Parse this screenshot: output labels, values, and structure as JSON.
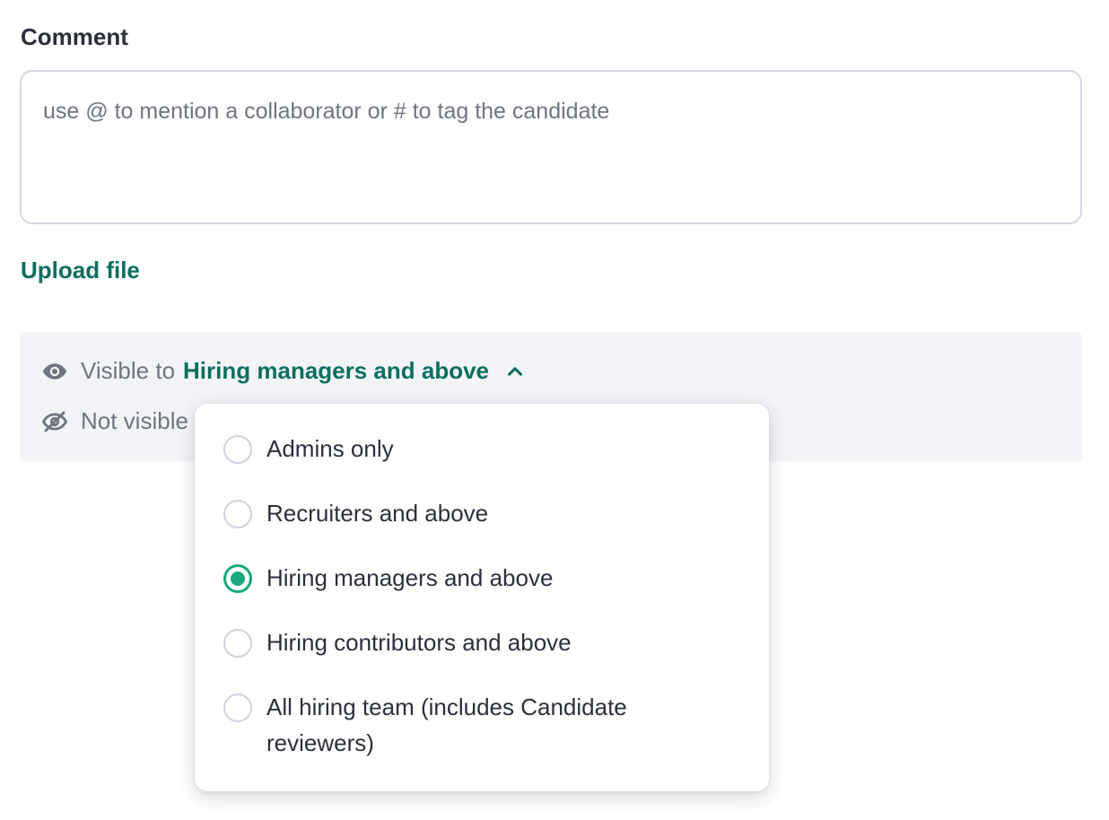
{
  "comment": {
    "label": "Comment",
    "placeholder": "use @ to mention a collaborator or # to tag the candidate",
    "value": ""
  },
  "upload": {
    "label": "Upload file"
  },
  "visibility": {
    "visible_prefix": "Visible to",
    "visible_selected": "Hiring managers and above",
    "not_visible_prefix": "Not visible",
    "icons": {
      "visible": "eye-icon",
      "not_visible": "eye-off-icon",
      "toggle": "chevron-up-icon"
    }
  },
  "dropdown": {
    "options": [
      {
        "label": "Admins only",
        "checked": false
      },
      {
        "label": "Recruiters and above",
        "checked": false
      },
      {
        "label": "Hiring managers and above",
        "checked": true
      },
      {
        "label": "Hiring contributors and above",
        "checked": false
      },
      {
        "label": "All hiring team (includes Candidate reviewers)",
        "checked": false
      }
    ]
  },
  "colors": {
    "accent": "#0b6e5f",
    "radio_checked": "#1aa87d",
    "panel_bg": "#f3f4f8",
    "muted_text": "#6f7580"
  }
}
